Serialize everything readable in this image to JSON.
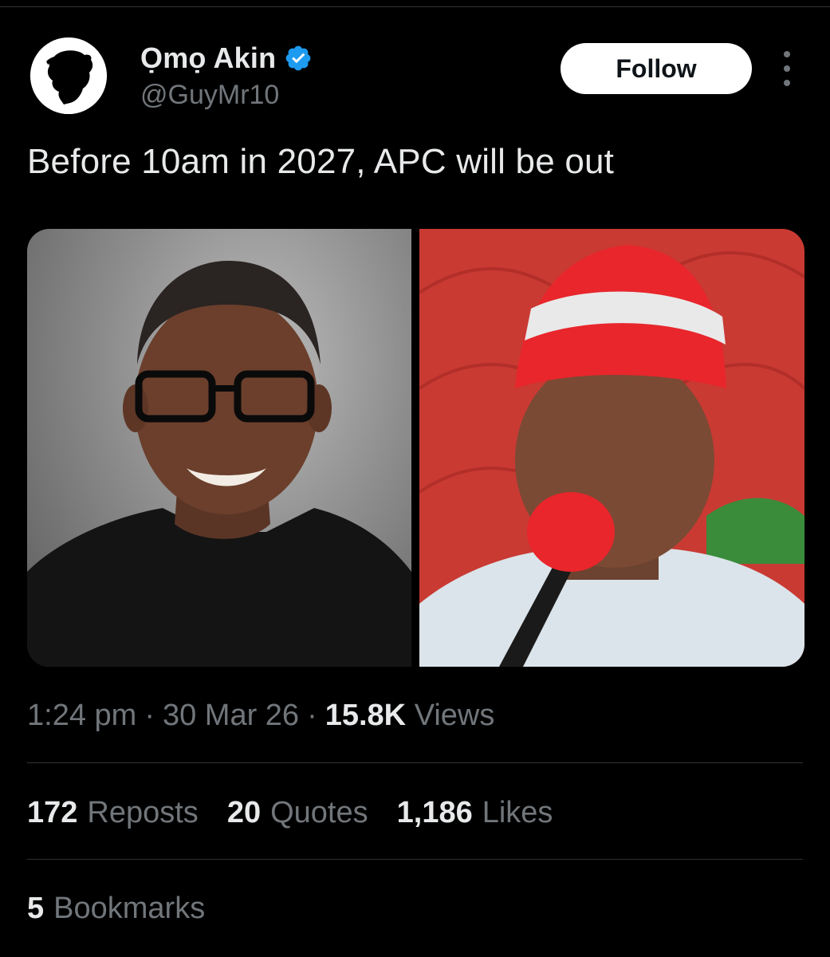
{
  "author": {
    "display_name": "Ọmọ Akin",
    "handle": "@GuyMr10",
    "verified": true,
    "avatar_icon": "silhouette-avatar-icon"
  },
  "actions": {
    "follow_label": "Follow",
    "more_icon": "more-vertical-icon"
  },
  "tweet": {
    "text": "Before 10am in 2027, APC will be out"
  },
  "meta": {
    "time": "1:24 pm",
    "separator": "·",
    "date": "30 Mar 26",
    "views_count": "15.8K",
    "views_label": "Views"
  },
  "stats": {
    "reposts_count": "172",
    "reposts_label": "Reposts",
    "quotes_count": "20",
    "quotes_label": "Quotes",
    "likes_count": "1,186",
    "likes_label": "Likes",
    "bookmarks_count": "5",
    "bookmarks_label": "Bookmarks"
  },
  "colors": {
    "background": "#000000",
    "text_primary": "#e7e9ea",
    "text_secondary": "#71767b",
    "divider": "#2f3336",
    "verified_blue": "#1d9bf0"
  }
}
